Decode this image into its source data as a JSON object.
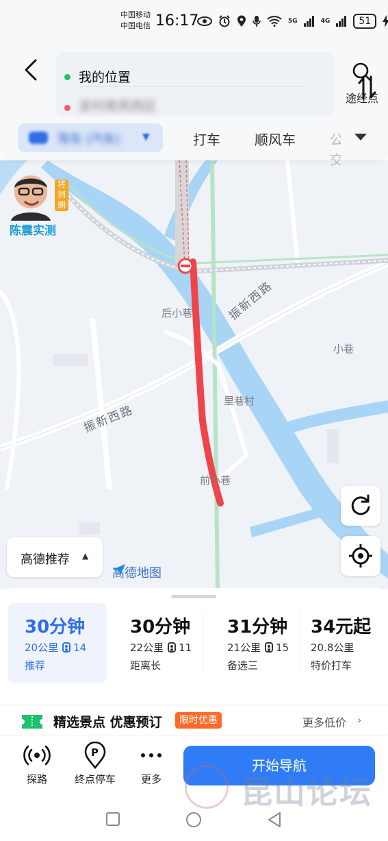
{
  "status_bar": {
    "carrier_1": "中国移动",
    "carrier_2": "中国电信",
    "time": "16:17",
    "net_5g": "5G",
    "net_4g": "4G",
    "battery": "51"
  },
  "header": {
    "from": "我的位置",
    "to": "吴村南苑西区",
    "waypoint_label": "途经点"
  },
  "mode_tabs": {
    "selected": "驾车 (汽车)",
    "taxi": "打车",
    "ride": "顺风车",
    "bus": "公交"
  },
  "map": {
    "labels": [
      "后小巷",
      "小巷",
      "里巷村",
      "前小巷"
    ],
    "road_name_1": "振新西路",
    "road_name_2": "振新西路",
    "badge_tag": "将到期",
    "badge_name": "陈震实测",
    "recommend_label": "高德推荐",
    "logo": "高德地图"
  },
  "route_options": [
    {
      "time": "30分钟",
      "distance": "20公里",
      "lights": "14",
      "tag": "推荐"
    },
    {
      "time": "30分钟",
      "distance": "22公里",
      "lights": "11",
      "tag": "距离长"
    },
    {
      "time": "31分钟",
      "distance": "21公里",
      "lights": "15",
      "tag": "备选三"
    },
    {
      "time": "34元起",
      "distance": "20.8公里",
      "lights": "",
      "tag": "特价打车"
    }
  ],
  "promo": {
    "title": "精选景点 优惠预订",
    "badge": "限时优惠",
    "more": "更多低价"
  },
  "toolbar": {
    "explore": "探路",
    "parking": "终点停车",
    "more": "更多",
    "start": "开始导航"
  },
  "watermark": "昆山论坛",
  "colors": {
    "accent": "#2f7cf6",
    "route": "#f0444c",
    "water": "#a8d4f5",
    "promo_badge": "#ff6a2b"
  }
}
